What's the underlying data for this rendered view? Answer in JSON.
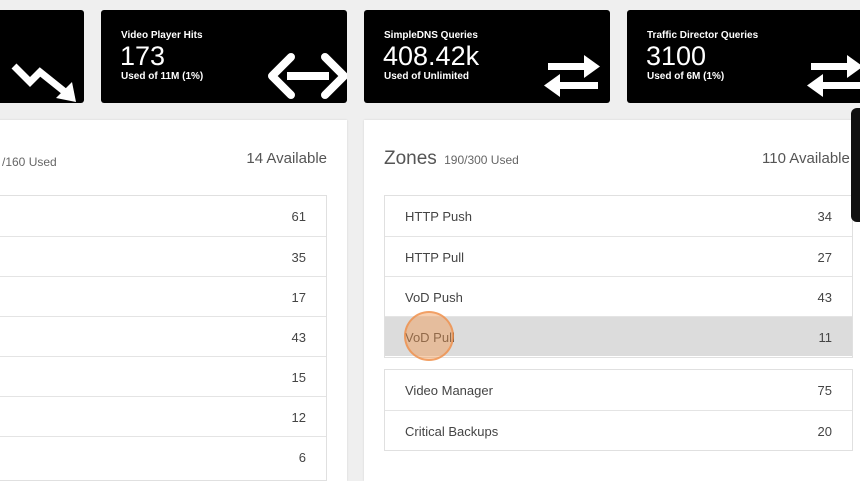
{
  "stat_cards": [
    {
      "label": "",
      "value": "",
      "usage": "",
      "icon": "trend-down-icon"
    },
    {
      "label": "Video Player Hits",
      "value": "173",
      "usage": "Used of 11M (1%)",
      "icon": "double-arrow-horizontal-icon"
    },
    {
      "label": "SimpleDNS Queries",
      "value": "408.42k",
      "usage": "Used of Unlimited",
      "icon": "swap-arrows-icon"
    },
    {
      "label": "Traffic Director Queries",
      "value": "3100",
      "usage": "Used of 6M (1%)",
      "icon": "swap-arrows-icon"
    }
  ],
  "left_panel": {
    "subtitle": "/160 Used",
    "available": "14 Available",
    "rows": [
      {
        "name": "",
        "count": "61"
      },
      {
        "name": "",
        "count": "35"
      },
      {
        "name": "",
        "count": "17"
      },
      {
        "name": "",
        "count": "43"
      },
      {
        "name": "",
        "count": "15"
      },
      {
        "name": "",
        "count": "12"
      },
      {
        "name": "",
        "count": "6"
      }
    ]
  },
  "zones_panel": {
    "title": "Zones",
    "subtitle": "190/300 Used",
    "available": "110 Available",
    "group1": [
      {
        "name": "HTTP Push",
        "count": "34"
      },
      {
        "name": "HTTP Pull",
        "count": "27"
      },
      {
        "name": "VoD Push",
        "count": "43"
      },
      {
        "name": "VoD Pull",
        "count": "11"
      }
    ],
    "group2": [
      {
        "name": "Video Manager",
        "count": "75"
      },
      {
        "name": "Critical Backups",
        "count": "20"
      }
    ]
  },
  "colors": {
    "card_bg": "#000000",
    "page_bg": "#efefef",
    "selected_row": "#dcdcdc",
    "click_marker": "#f0964f"
  }
}
